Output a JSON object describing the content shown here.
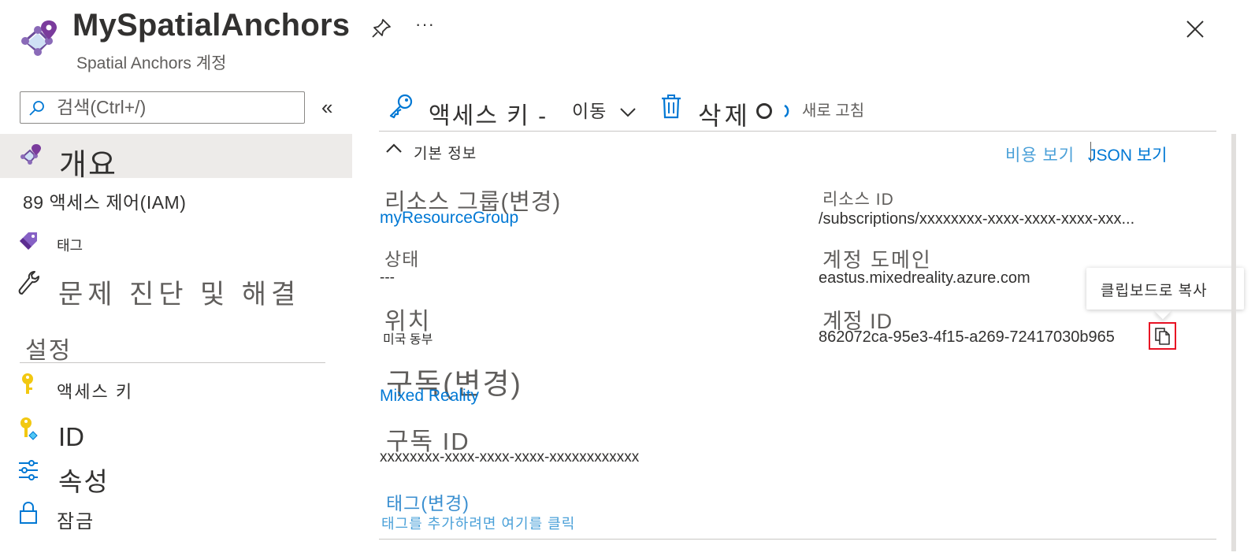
{
  "header": {
    "title": "MySpatialAnchors",
    "subtitle": "Spatial Anchors 계정",
    "icon": "spatial-anchors-icon",
    "more": "···"
  },
  "sidebar": {
    "search_placeholder": "검색(Ctrl+/)",
    "collapse": "«",
    "items": [
      {
        "label": "개요",
        "icon": "spatial-anchors-icon"
      },
      {
        "label": "89 액세스 제어(IAM)",
        "icon": "people-icon"
      },
      {
        "label": "태그",
        "icon": "tag-icon"
      },
      {
        "label": "문제 진단 및 해결",
        "icon": "wrench-icon"
      }
    ],
    "settings_header": "설정",
    "settings_items": [
      {
        "label": "액세스 키",
        "icon": "key-icon"
      },
      {
        "label": "ID",
        "icon": "identity-key-icon"
      },
      {
        "label": "속성",
        "icon": "sliders-icon"
      },
      {
        "label": "잠금",
        "icon": "lock-icon"
      }
    ]
  },
  "toolbar": {
    "keys_label": "액세스 키 -",
    "move_label": "이동",
    "delete_label": "삭제",
    "refresh_label": "새로 고침"
  },
  "essentials": {
    "toggle_label": "기본 정보",
    "cost_link": "비용 보기",
    "json_link": "JSON 보기",
    "left": {
      "resource_group_label": "리소스 그룹(변경)",
      "resource_group_value": "myResourceGroup",
      "status_label": "상태",
      "status_value": "---",
      "location_label": "위치",
      "location_value": "미국 동부",
      "subscription_label": "구독(변경)",
      "subscription_value": "Mixed Reality",
      "subscription_id_label": "구독 ID",
      "subscription_id_value": "xxxxxxxx-xxxx-xxxx-xxxx-xxxxxxxxxxxx",
      "tags_label": "태그(변경)",
      "tags_value": "태그를 추가하려면 여기를 클릭"
    },
    "right": {
      "resource_id_label": "리소스 ID",
      "resource_id_value": "/subscriptions/xxxxxxxx-xxxx-xxxx-xxxx-xxx...",
      "domain_label": "계정 도메인",
      "domain_value": "eastus.mixedreality.azure.com",
      "account_id_label": "계정 ID",
      "account_id_value": "862072ca-95e3-4f15-a269-72417030b965"
    },
    "tooltip": "클립보드로 복사"
  },
  "colors": {
    "link": "#0078d4",
    "selected_bg": "#edebe9",
    "highlight_border": "#e81123",
    "brand_purple": "#7a3b9c"
  }
}
